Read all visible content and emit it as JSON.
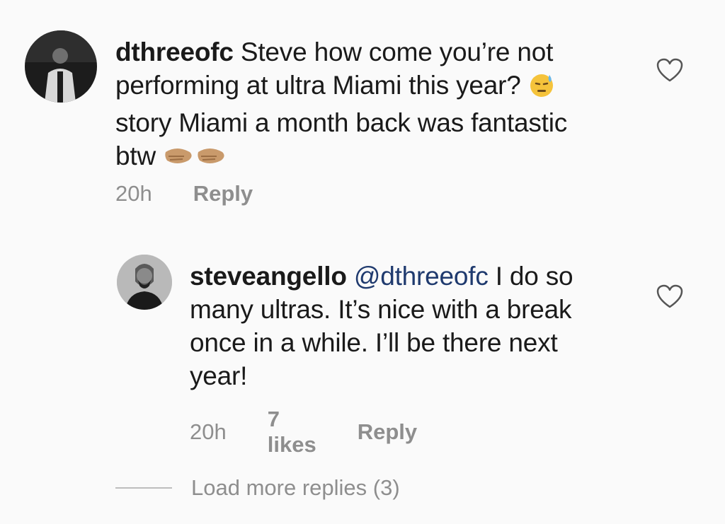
{
  "comments": [
    {
      "username": "dthreeofc",
      "text_line1": "Steve how come you’re not",
      "text_line2": "performing at ultra Miami this year?",
      "text_line3": "story Miami a month back was fantastic",
      "text_line4": "btw",
      "emoji_1": "downcast-sweat-face-icon",
      "emoji_2": "clapping-hands-icon",
      "time": "20h",
      "reply_label": "Reply"
    },
    {
      "username": "steveangello",
      "mention": "@dthreeofc",
      "text_line1": " I do so",
      "text_line2": "many ultras. It’s nice with a break",
      "text_line3": "once in a while. I’ll be there next",
      "text_line4": "year!",
      "time": "20h",
      "likes": "7 likes",
      "reply_label": "Reply"
    }
  ],
  "load_more": {
    "label": "Load more replies (3)"
  },
  "colors": {
    "background": "#fafafa",
    "meta_text": "#8e8e8e",
    "mention": "#1f3a6e"
  }
}
